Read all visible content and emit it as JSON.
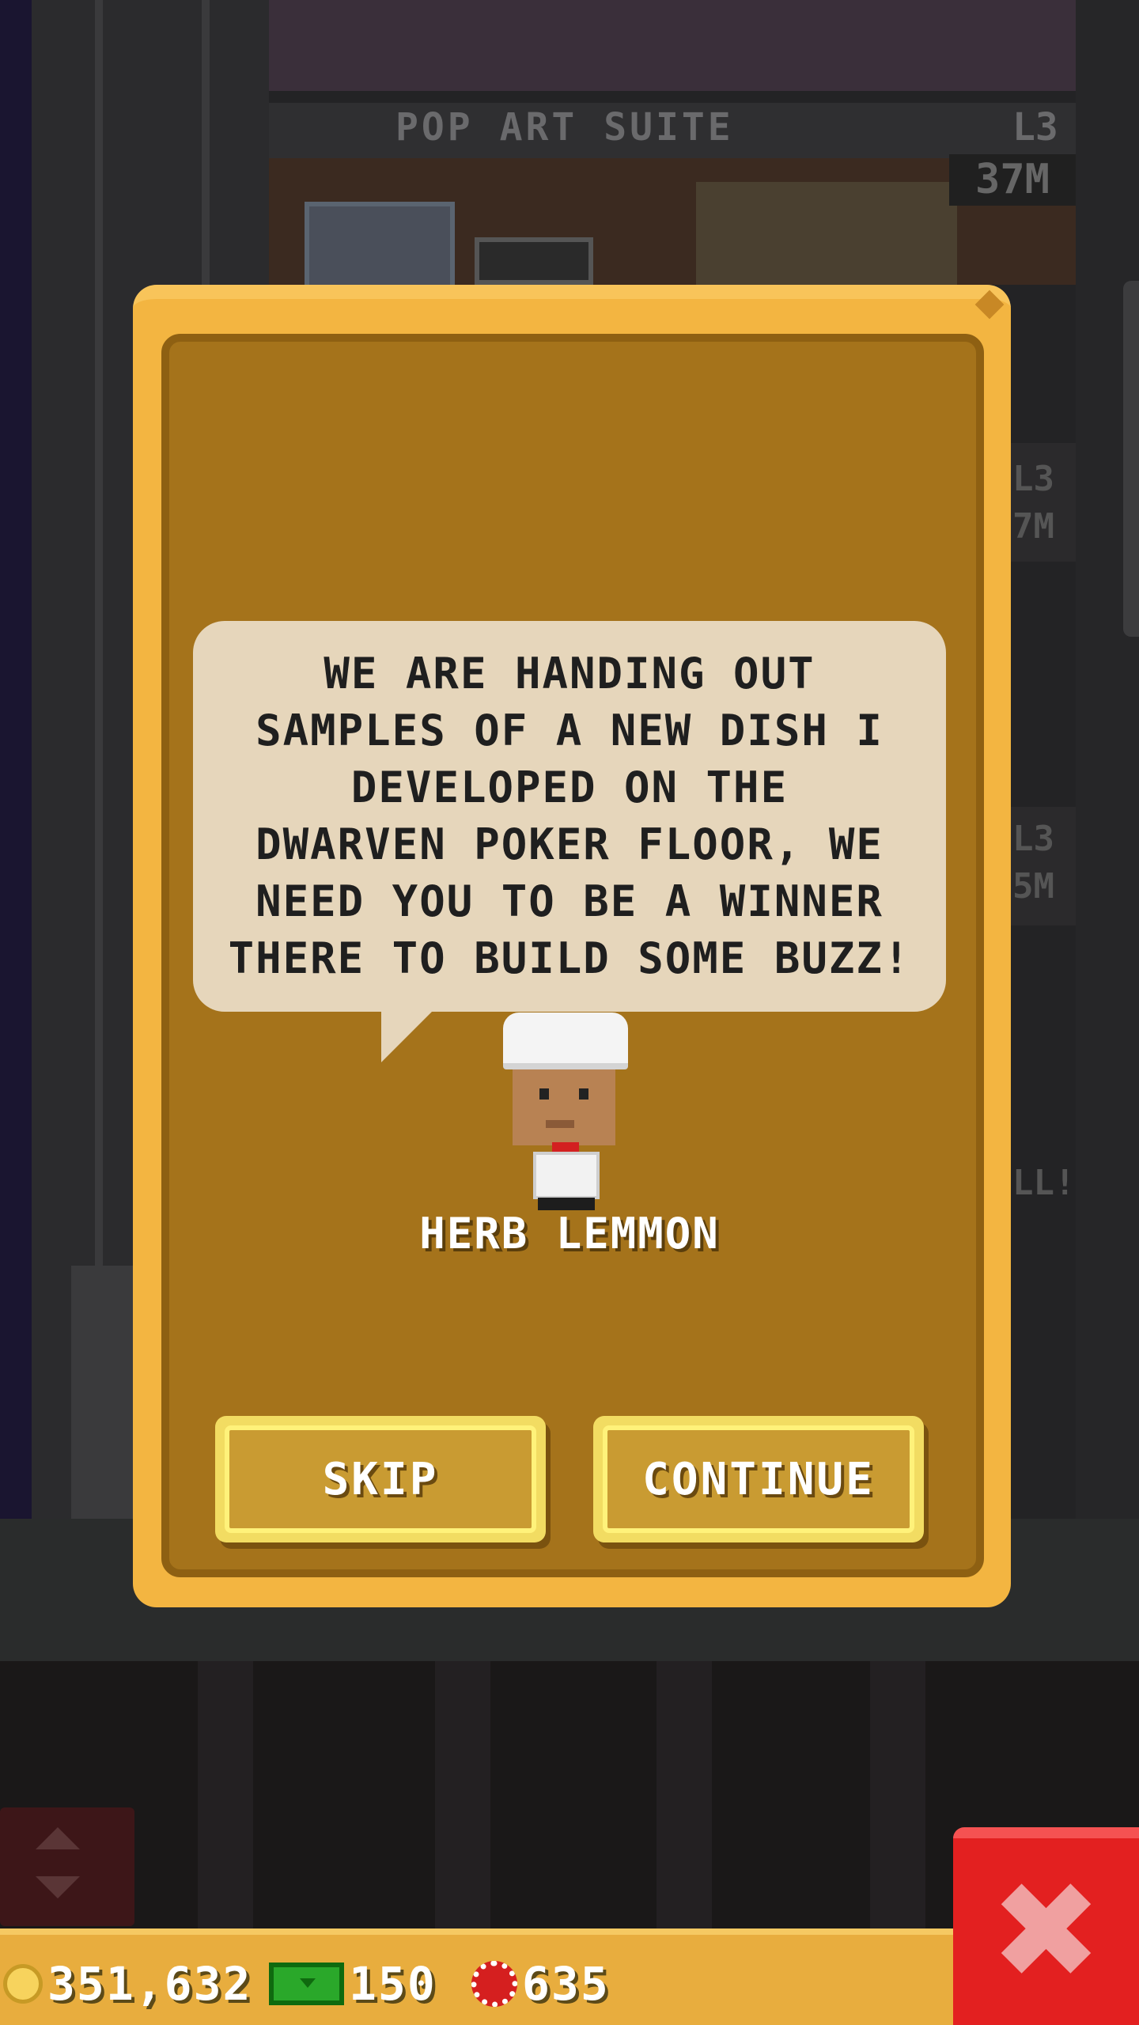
{
  "background": {
    "floor_title": "POP ART SUITE",
    "floor_level": "L3",
    "floor_price": "37M",
    "side_tags": [
      "L3",
      "7M",
      "L3",
      "5M",
      "LL!"
    ]
  },
  "dialog": {
    "message": "WE ARE HANDING OUT\nSAMPLES OF A NEW DISH I\nDEVELOPED ON THE\nDWARVEN POKER FLOOR, WE\nNEED YOU TO BE A WINNER\nTHERE TO BUILD SOME BUZZ!",
    "character_name": "HERB LEMMON",
    "skip_label": "SKIP",
    "continue_label": "CONTINUE"
  },
  "hud": {
    "coins": "351,632",
    "bux": "150",
    "chips": "635"
  },
  "icons": {
    "coin": "coin-icon",
    "bux": "tower-bux-icon",
    "chip": "poker-chip-icon",
    "close": "close-icon",
    "elevator": "elevator-up-down-icon"
  },
  "colors": {
    "dialog_border": "#f3b541",
    "dialog_fill": "#a5731b",
    "bubble": "#e6d6bb",
    "close_button": "#e32020",
    "hud_bar": "#e8ad3e"
  }
}
